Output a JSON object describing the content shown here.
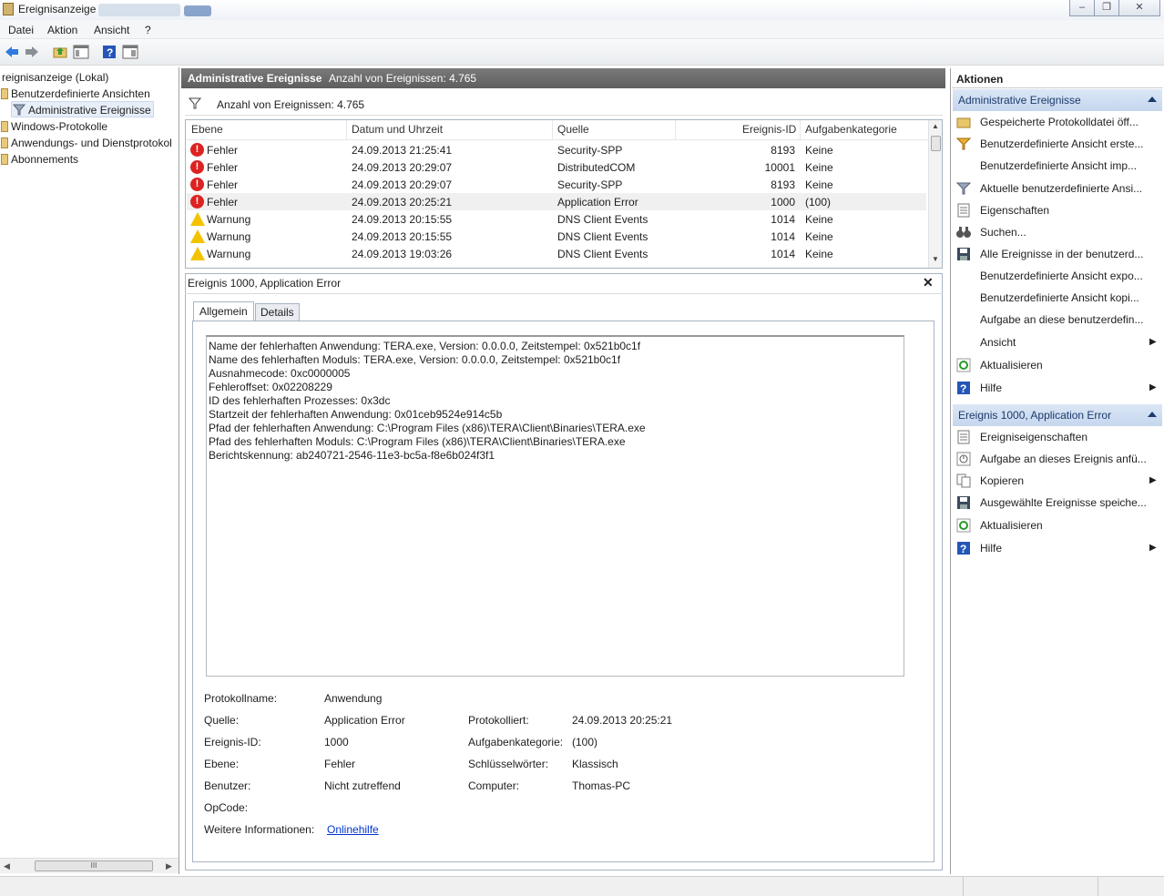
{
  "window": {
    "title": "Ereignisanzeige",
    "controls": [
      "–",
      "❐",
      "✕"
    ]
  },
  "menu": [
    "Datei",
    "Aktion",
    "Ansicht",
    "?"
  ],
  "toolbar": {
    "icons": [
      "back-arrow-icon",
      "forward-arrow-icon",
      "folder-up-icon",
      "show-hide-console-tree-icon",
      "help-icon",
      "show-hide-action-pane-icon"
    ]
  },
  "tree": {
    "root": "reignisanzeige (Lokal)",
    "items": [
      {
        "label": "Benutzerdefinierte Ansichten"
      },
      {
        "label": "Administrative Ereignisse"
      },
      {
        "label": "Windows-Protokolle"
      },
      {
        "label": "Anwendungs- und Dienstprotokol"
      },
      {
        "label": "Abonnements"
      }
    ],
    "scroll_grip": "III"
  },
  "center": {
    "header_title": "Administrative Ereignisse",
    "header_count": "Anzahl von Ereignissen: 4.765",
    "filter_text": "Anzahl von Ereignissen: 4.765",
    "columns": [
      "Ebene",
      "Datum und Uhrzeit",
      "Quelle",
      "Ereignis-ID",
      "Aufgabenkategorie"
    ],
    "rows": [
      {
        "level": "Fehler",
        "date": "24.09.2013 21:25:41",
        "source": "Security-SPP",
        "id": "8193",
        "cat": "Keine"
      },
      {
        "level": "Fehler",
        "date": "24.09.2013 20:29:07",
        "source": "DistributedCOM",
        "id": "10001",
        "cat": "Keine"
      },
      {
        "level": "Fehler",
        "date": "24.09.2013 20:29:07",
        "source": "Security-SPP",
        "id": "8193",
        "cat": "Keine"
      },
      {
        "level": "Fehler",
        "date": "24.09.2013 20:25:21",
        "source": "Application Error",
        "id": "1000",
        "cat": "(100)"
      },
      {
        "level": "Warnung",
        "date": "24.09.2013 20:15:55",
        "source": "DNS Client Events",
        "id": "1014",
        "cat": "Keine"
      },
      {
        "level": "Warnung",
        "date": "24.09.2013 20:15:55",
        "source": "DNS Client Events",
        "id": "1014",
        "cat": "Keine"
      },
      {
        "level": "Warnung",
        "date": "24.09.2013 19:03:26",
        "source": "DNS Client Events",
        "id": "1014",
        "cat": "Keine"
      }
    ]
  },
  "detail": {
    "title": "Ereignis 1000, Application Error",
    "close": "✕",
    "tabs": [
      "Allgemein",
      "Details"
    ],
    "message_lines": [
      "Name der fehlerhaften Anwendung: TERA.exe, Version: 0.0.0.0, Zeitstempel: 0x521b0c1f",
      "Name des fehlerhaften Moduls: TERA.exe, Version: 0.0.0.0, Zeitstempel: 0x521b0c1f",
      "Ausnahmecode: 0xc0000005",
      "Fehleroffset: 0x02208229",
      "ID des fehlerhaften Prozesses: 0x3dc",
      "Startzeit der fehlerhaften Anwendung: 0x01ceb9524e914c5b",
      "Pfad der fehlerhaften Anwendung: C:\\Program Files (x86)\\TERA\\Client\\Binaries\\TERA.exe",
      "Pfad des fehlerhaften Moduls: C:\\Program Files (x86)\\TERA\\Client\\Binaries\\TERA.exe",
      "Berichtskennung: ab240721-2546-11e3-bc5a-f8e6b024f3f1"
    ],
    "fields": {
      "protokollname_label": "Protokollname:",
      "protokollname": "Anwendung",
      "quelle_label": "Quelle:",
      "quelle": "Application Error",
      "protokolliert_label": "Protokolliert:",
      "protokolliert": "24.09.2013 20:25:21",
      "ereignisid_label": "Ereignis-ID:",
      "ereignisid": "1000",
      "aufgabenkategorie_label": "Aufgabenkategorie:",
      "aufgabenkategorie": "(100)",
      "ebene_label": "Ebene:",
      "ebene": "Fehler",
      "schluesselwoerter_label": "Schlüsselwörter:",
      "schluesselwoerter": "Klassisch",
      "benutzer_label": "Benutzer:",
      "benutzer": "Nicht zutreffend",
      "computer_label": "Computer:",
      "computer": "Thomas-PC",
      "opcode_label": "OpCode:",
      "weitere_label": "Weitere Informationen:",
      "weitere_link": "Onlinehilfe"
    }
  },
  "actions": {
    "title": "Aktionen",
    "section1_title": "Administrative Ereignisse",
    "section1_items": [
      "Gespeicherte Protokolldatei öff...",
      "Benutzerdefinierte Ansicht erste...",
      "Benutzerdefinierte Ansicht imp...",
      "Aktuelle benutzerdefinierte Ansi...",
      "Eigenschaften",
      "Suchen...",
      "Alle Ereignisse in der benutzerd...",
      "Benutzerdefinierte Ansicht expo...",
      "Benutzerdefinierte Ansicht kopi...",
      "Aufgabe an diese benutzerdefin...",
      "Ansicht",
      "Aktualisieren",
      "Hilfe"
    ],
    "section2_title": "Ereignis 1000, Application Error",
    "section2_items": [
      "Ereigniseigenschaften",
      "Aufgabe an dieses Ereignis anfü...",
      "Kopieren",
      "Ausgewählte Ereignisse speiche...",
      "Aktualisieren",
      "Hilfe"
    ]
  },
  "colors": {
    "header_bg": "#666666",
    "section_bg": "#c9d9ef",
    "error": "#dd2222",
    "warning": "#f3c300",
    "link": "#0033cc"
  }
}
